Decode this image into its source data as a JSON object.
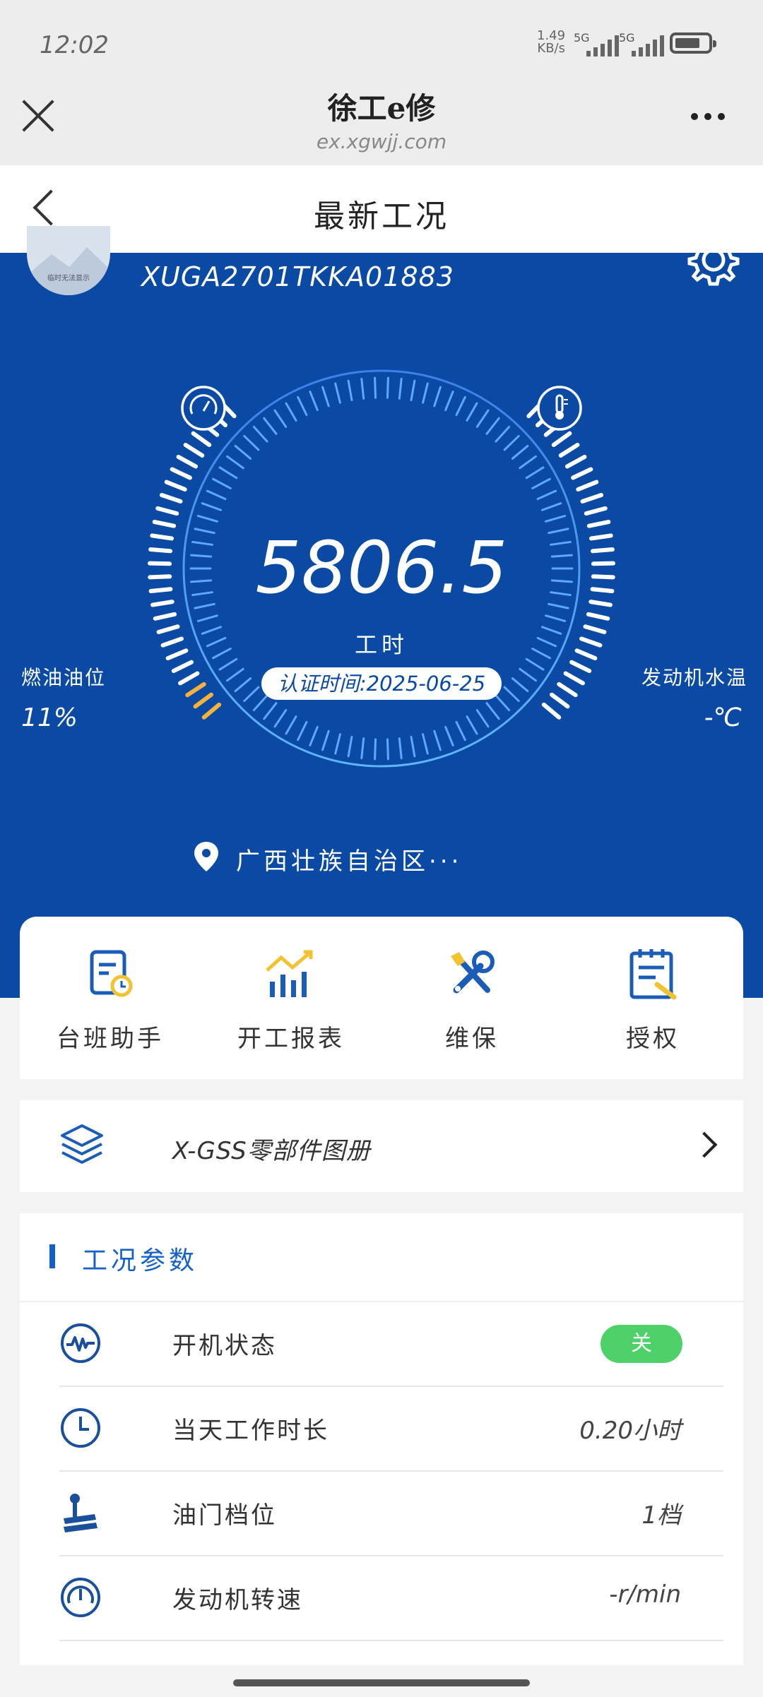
{
  "status_bar": {
    "time": "12:02",
    "net_speed_value": "1.49",
    "net_speed_unit": "KB/s",
    "sim1": "5G",
    "sim2": "5G"
  },
  "webview": {
    "title": "徐工e修",
    "url": "ex.xgwjj.com"
  },
  "page": {
    "title": "最新工况"
  },
  "hero": {
    "avatar_caption": "临时无法显示",
    "serial": "XUGA2701TKKA01883",
    "hours_value": "5806.5",
    "hours_unit": "工时",
    "cert_time": "认证时间:2025-06-25",
    "fuel_label": "燃油油位",
    "fuel_value": "11%",
    "fuel_level": 0.11,
    "temp_label": "发动机水温",
    "temp_value": "-℃",
    "location": "广西壮族自治区···",
    "colors": {
      "background": "#0a4aa4",
      "fuel_low": "#f4b23c",
      "tick": "#ffffff"
    }
  },
  "quick_actions": [
    {
      "label": "台班助手",
      "icon": "shift-assistant-icon"
    },
    {
      "label": "开工报表",
      "icon": "bar-chart-icon"
    },
    {
      "label": "维保",
      "icon": "wrench-icon"
    },
    {
      "label": "授权",
      "icon": "authorization-clipboard-icon"
    }
  ],
  "parts_book": {
    "label": "X-GSS零部件图册",
    "icon": "layers-icon"
  },
  "params": {
    "section_title": "工况参数",
    "rows": [
      {
        "label": "开机状态",
        "value": "关",
        "icon": "pulse-icon",
        "type": "toggle"
      },
      {
        "label": "当天工作时长",
        "value": "0.20小时",
        "icon": "clock-icon"
      },
      {
        "label": "油门档位",
        "value": "1档",
        "icon": "throttle-lever-icon"
      },
      {
        "label": "发动机转速",
        "value": "-r/min",
        "icon": "speedometer-icon"
      }
    ]
  }
}
